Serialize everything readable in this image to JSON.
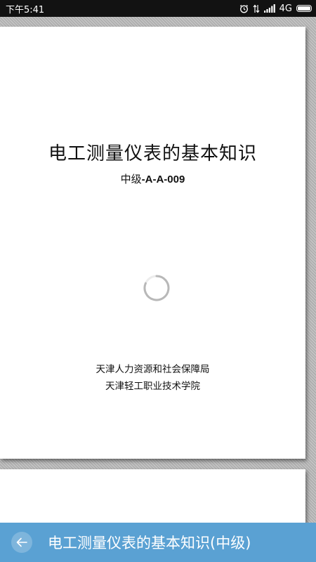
{
  "status_bar": {
    "time": "下午5:41",
    "network": "4G",
    "icons": [
      "alarm-icon",
      "data-arrows-icon",
      "signal-icon",
      "battery-icon"
    ]
  },
  "document": {
    "title": "电工测量仪表的基本知识",
    "subtitle_prefix": "中级",
    "subtitle_code": "-A-A-009",
    "org_line_1": "天津人力资源和社会保障局",
    "org_line_2": "天津轻工职业技术学院"
  },
  "bottom_bar": {
    "title": "电工测量仪表的基本知识(中级)",
    "back_icon": "back-arrow-icon",
    "color": "#5aa1d3"
  }
}
